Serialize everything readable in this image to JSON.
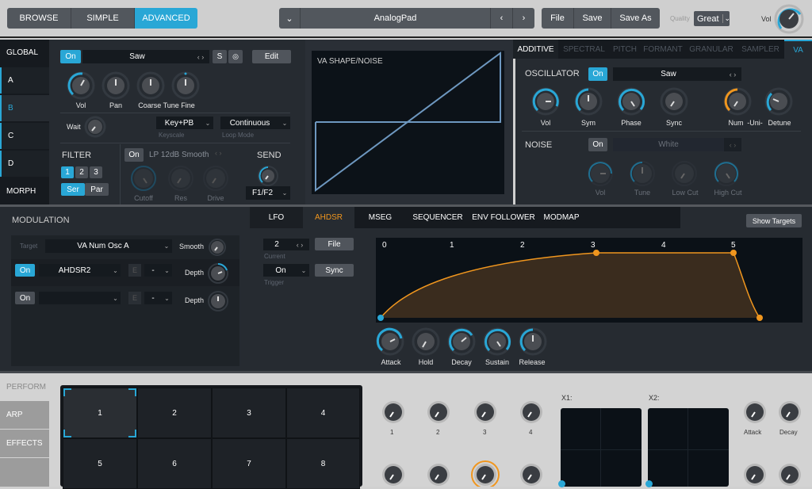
{
  "header": {
    "modes": [
      {
        "label": "BROWSE",
        "active": false
      },
      {
        "label": "SIMPLE",
        "active": false
      },
      {
        "label": "ADVANCED",
        "active": true
      }
    ],
    "preset_name": "AnalogPad",
    "file_label": "File",
    "save_label": "Save",
    "save_as_label": "Save As",
    "quality_label": "Quality",
    "quality_value": "Great",
    "vol_label": "Vol",
    "vol_value": 0.75
  },
  "left_tabs": [
    "GLOBAL",
    "A",
    "B",
    "C",
    "D",
    "MORPH"
  ],
  "selected_tab": "B",
  "osc_section": {
    "on_label": "On",
    "waveform": "Saw",
    "s_label": "S",
    "edit_label": "Edit",
    "knobs": [
      {
        "label": "Vol",
        "value": 0.7
      },
      {
        "label": "Pan",
        "value": 0.5
      },
      {
        "label": "Coarse Tune",
        "value": 0.5
      },
      {
        "label": "Fine",
        "value": 0.5
      }
    ],
    "wait_label": "Wait",
    "wait_value": 0.2,
    "keyscale_value": "Key+PB",
    "keyscale_label": "Keyscale",
    "loop_value": "Continuous",
    "loop_label": "Loop Mode"
  },
  "filter": {
    "title": "FILTER",
    "slots": [
      "1",
      "2",
      "3"
    ],
    "selected_slot": "1",
    "routing": [
      "Ser",
      "Par"
    ],
    "selected_routing": "Ser",
    "on_label": "On",
    "type": "LP 12dB Smooth",
    "knobs": [
      {
        "label": "Cutoff"
      },
      {
        "label": "Res"
      },
      {
        "label": "Drive"
      }
    ],
    "send_title": "SEND",
    "send_value": "F1/F2"
  },
  "shape_display": {
    "title": "VA SHAPE/NOISE"
  },
  "engine_tabs": [
    "ADDITIVE",
    "SPECTRAL",
    "PITCH",
    "FORMANT",
    "GRANULAR",
    "SAMPLER",
    "VA"
  ],
  "active_engine_tab": "VA",
  "oscillator": {
    "title": "OSCILLATOR",
    "on_label": "On",
    "waveform": "Saw",
    "knobs": [
      {
        "label": "Vol"
      },
      {
        "label": "Sym"
      },
      {
        "label": "Phase"
      },
      {
        "label": "Sync"
      },
      {
        "label": "Num"
      },
      {
        "label": "-Uni-"
      },
      {
        "label": "Detune"
      }
    ]
  },
  "noise": {
    "title": "NOISE",
    "on_label": "On",
    "type": "White",
    "knobs": [
      {
        "label": "Vol"
      },
      {
        "label": "Tune"
      },
      {
        "label": "Low Cut"
      },
      {
        "label": "High Cut"
      }
    ]
  },
  "modulation": {
    "title": "MODULATION",
    "target_label": "Target",
    "target_value": "VA Num Osc A",
    "smooth_label": "Smooth",
    "rows": [
      {
        "on_label": "On",
        "source": "AHDSR2",
        "e_label": "E",
        "mode": "-",
        "depth_label": "Depth",
        "active": true
      },
      {
        "on_label": "On",
        "source": "",
        "e_label": "E",
        "mode": "-",
        "depth_label": "Depth",
        "active": false
      }
    ]
  },
  "mod_tabs": [
    "LFO",
    "AHDSR",
    "MSEG",
    "SEQUENCER",
    "ENV FOLLOWER",
    "MODMAP"
  ],
  "active_mod_tab": "AHDSR",
  "show_targets_label": "Show Targets",
  "ahdsr": {
    "current_value": "2",
    "current_label": "Current",
    "file_label": "File",
    "trigger_value": "On",
    "trigger_label": "Trigger",
    "sync_label": "Sync",
    "ruler": [
      "0",
      "1",
      "2",
      "3",
      "4",
      "5"
    ],
    "knobs": [
      {
        "label": "Attack"
      },
      {
        "label": "Hold"
      },
      {
        "label": "Decay"
      },
      {
        "label": "Sustain"
      },
      {
        "label": "Release"
      }
    ]
  },
  "perform": {
    "tabs": [
      "PERFORM",
      "ARP",
      "EFFECTS"
    ],
    "pads": [
      "1",
      "2",
      "3",
      "4",
      "5",
      "6",
      "7",
      "8"
    ],
    "selected_pad": "1",
    "macro_labels": [
      "1",
      "2",
      "3",
      "4"
    ],
    "xy_labels": [
      "X1:",
      "X2:"
    ],
    "env_labels": [
      "Attack",
      "Decay"
    ]
  },
  "colors": {
    "accent": "#29a7d6",
    "orange": "#f0961e",
    "panel": "#262b31"
  }
}
